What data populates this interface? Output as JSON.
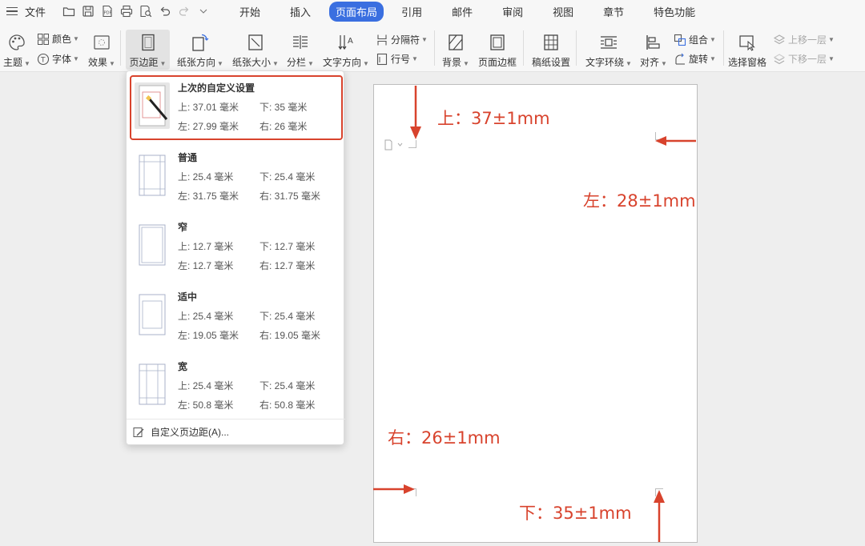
{
  "menubar": {
    "file_label": "文件",
    "tabs": [
      "开始",
      "插入",
      "页面布局",
      "引用",
      "邮件",
      "审阅",
      "视图",
      "章节",
      "特色功能"
    ],
    "active_tab": "页面布局"
  },
  "ribbon": {
    "theme": "主题",
    "color": "颜色",
    "font": "字体",
    "effects": "效果",
    "margins": "页边距",
    "orientation": "纸张方向",
    "paper_size": "纸张大小",
    "columns": "分栏",
    "text_direction": "文字方向",
    "breaks": "分隔符",
    "line_numbers": "行号",
    "background": "背景",
    "page_border": "页面边框",
    "manuscript": "稿纸设置",
    "text_wrap": "文字环绕",
    "align": "对齐",
    "group": "组合",
    "rotate": "旋转",
    "selection_pane": "选择窗格",
    "bring_forward": "上移一层",
    "send_backward": "下移一层"
  },
  "margins_menu": {
    "presets": [
      {
        "title": "上次的自定义设置",
        "top": "上: 37.01 毫米",
        "bottom": "下: 35 毫米",
        "left": "左: 27.99 毫米",
        "right": "右: 26 毫米"
      },
      {
        "title": "普通",
        "top": "上: 25.4 毫米",
        "bottom": "下: 25.4 毫米",
        "left": "左: 31.75 毫米",
        "right": "右: 31.75 毫米"
      },
      {
        "title": "窄",
        "top": "上: 12.7 毫米",
        "bottom": "下: 12.7 毫米",
        "left": "左: 12.7 毫米",
        "right": "右: 12.7 毫米"
      },
      {
        "title": "适中",
        "top": "上: 25.4 毫米",
        "bottom": "下: 25.4 毫米",
        "left": "左: 19.05 毫米",
        "right": "右: 19.05 毫米"
      },
      {
        "title": "宽",
        "top": "上: 25.4 毫米",
        "bottom": "下: 25.4 毫米",
        "left": "左: 50.8 毫米",
        "right": "右: 50.8 毫米"
      }
    ],
    "custom_label": "自定义页边距(A)..."
  },
  "annotations": {
    "top": "上：37±1mm",
    "left": "左：28±1mm",
    "right": "右：26±1mm",
    "bottom": "下：35±1mm"
  },
  "colors": {
    "accent": "#3a6fe0",
    "annotation": "#d8432d"
  }
}
